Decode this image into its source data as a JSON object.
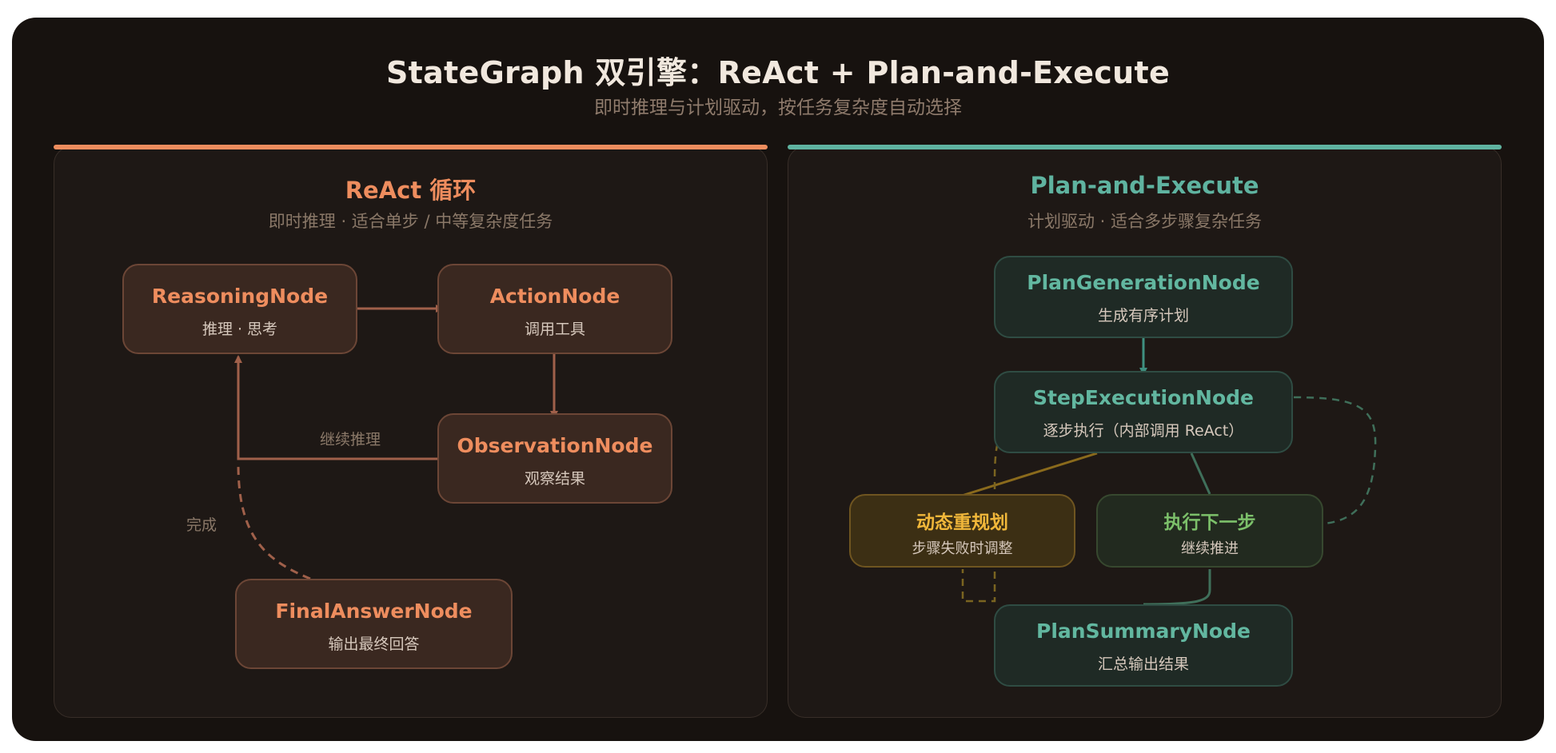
{
  "header": {
    "title": "StateGraph 双引擎：ReAct + Plan-and-Execute",
    "subtitle": "即时推理与计划驱动，按任务复杂度自动选择"
  },
  "react": {
    "title": "ReAct 循环",
    "subtitle": "即时推理 · 适合单步 / 中等复杂度任务",
    "nodes": {
      "reasoning": {
        "title": "ReasoningNode",
        "sub": "推理 · 思考"
      },
      "action": {
        "title": "ActionNode",
        "sub": "调用工具"
      },
      "observation": {
        "title": "ObservationNode",
        "sub": "观察结果"
      },
      "final": {
        "title": "FinalAnswerNode",
        "sub": "输出最终回答"
      }
    },
    "edge_labels": {
      "continue": "继续推理",
      "done": "完成"
    }
  },
  "plan": {
    "title": "Plan-and-Execute",
    "subtitle": "计划驱动 · 适合多步骤复杂任务",
    "nodes": {
      "generation": {
        "title": "PlanGenerationNode",
        "sub": "生成有序计划"
      },
      "step": {
        "title": "StepExecutionNode",
        "sub": "逐步执行（内部调用 ReAct）"
      },
      "replan": {
        "title": "动态重规划",
        "sub": "步骤失败时调整"
      },
      "next": {
        "title": "执行下一步",
        "sub": "继续推进"
      },
      "summary": {
        "title": "PlanSummaryNode",
        "sub": "汇总输出结果"
      }
    }
  },
  "colors": {
    "react_accent": "#ee8d5e",
    "plan_accent": "#5fb3a0",
    "replan_accent": "#f1b73a",
    "next_accent": "#7cc06a",
    "background": "#17120f"
  }
}
